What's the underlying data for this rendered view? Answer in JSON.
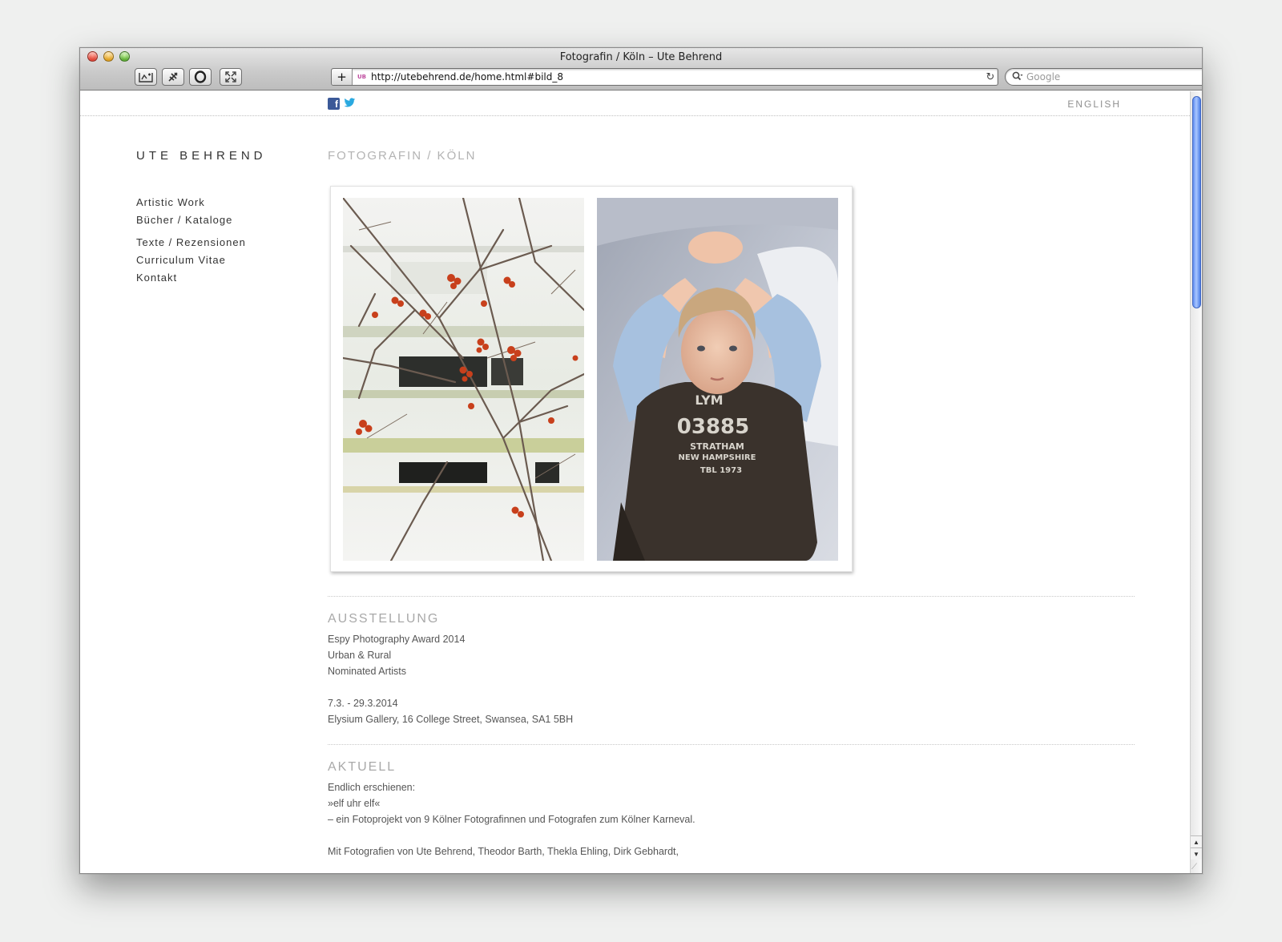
{
  "window": {
    "title": "Fotografin / Köln – Ute Behrend",
    "url": "http://utebehrend.de/home.html#bild_8",
    "favicon_text": "UB",
    "search_placeholder": "Google"
  },
  "toolbar": {
    "icons": [
      "back-icon",
      "forward-icon",
      "bookmark-icon",
      "bug-icon",
      "opera-icon",
      "fullscreen-icon",
      "add-icon",
      "reload-icon",
      "search-icon"
    ]
  },
  "site": {
    "brand": "UTE BEHREND",
    "subtitle": "FOTOGRAFIN / KÖLN",
    "language_link": "ENGLISH",
    "social": {
      "facebook": "f",
      "twitter": "t"
    },
    "nav": [
      "Artistic Work",
      "Bücher / Kataloge",
      "Texte / Rezensionen",
      "Curriculum Vitae",
      "Kontakt"
    ]
  },
  "sections": {
    "ausstellung": {
      "heading": "AUSSTELLUNG",
      "lines": [
        "Espy Photography Award 2014",
        "Urban & Rural",
        "Nominated Artists",
        "",
        "7.3. - 29.3.2014",
        "Elysium Gallery, 16 College Street, Swansea, SA1 5BH"
      ]
    },
    "aktuell": {
      "heading": "AKTUELL",
      "lines": [
        "Endlich erschienen:",
        "»elf uhr elf«",
        "– ein Fotoprojekt von 9 Kölner Fotografinnen und Fotografen zum Kölner Karneval.",
        "",
        "Mit Fotografien von Ute Behrend, Theodor Barth, Thekla Ehling, Dirk Gebhardt,"
      ]
    }
  },
  "photos": {
    "shirt_text": [
      "LYM",
      "03885",
      "STRATHAM",
      "NEW HAMPSHIRE",
      "TBL 1973"
    ]
  },
  "colors": {
    "accent_gray": "#a9a9a9",
    "facebook": "#3b5998",
    "twitter": "#2aa9e0",
    "scroll_thumb": "#5f8cf0"
  }
}
